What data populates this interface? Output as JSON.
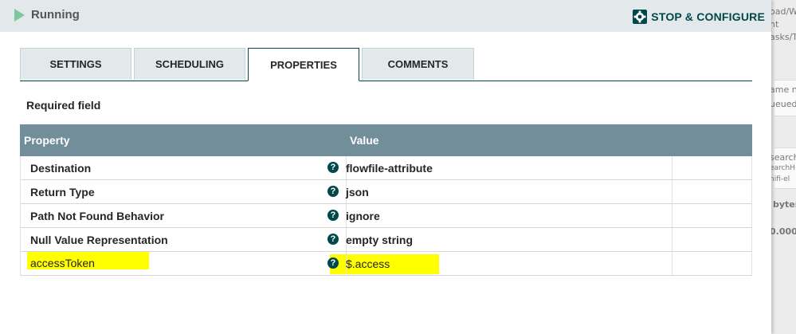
{
  "header": {
    "status_label": "Running",
    "stop_configure_label": "STOP & CONFIGURE"
  },
  "tabs": [
    {
      "label": "SETTINGS",
      "active": false
    },
    {
      "label": "SCHEDULING",
      "active": false
    },
    {
      "label": "PROPERTIES",
      "active": true
    },
    {
      "label": "COMMENTS",
      "active": false
    }
  ],
  "required_label": "Required field",
  "grid": {
    "columns": [
      "Property",
      "Value"
    ],
    "rows": [
      {
        "property": "Destination",
        "value": "flowfile-attribute"
      },
      {
        "property": "Return Type",
        "value": "json"
      },
      {
        "property": "Path Not Found Behavior",
        "value": "ignore"
      },
      {
        "property": "Null Value Representation",
        "value": "empty string"
      },
      {
        "property": "accessToken",
        "value": "$.access"
      }
    ],
    "help_glyph": "?"
  },
  "background": {
    "fragments": [
      "oad/W",
      "nt",
      "asks/T",
      "ame n",
      "ueued",
      "search",
      "earchH",
      "nifi-el",
      "bytes",
      "0.000"
    ]
  },
  "colors": {
    "accent": "#004849",
    "header_bg": "#e3e8eb",
    "grid_header": "#728e9b",
    "running": "#7dc7a0",
    "highlight": "#ffff00"
  }
}
